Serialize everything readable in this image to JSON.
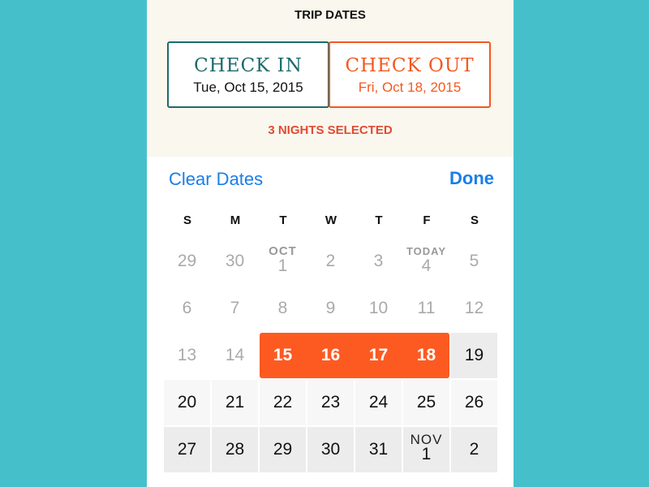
{
  "header": {
    "title": "TRIP DATES",
    "check_in": {
      "label": "CHECK IN",
      "date": "Tue, Oct 15, 2015"
    },
    "check_out": {
      "label": "CHECK OUT",
      "date": "Fri, Oct 18, 2015"
    },
    "nights": "3 NIGHTS SELECTED"
  },
  "toolbar": {
    "clear_label": "Clear Dates",
    "done_label": "Done"
  },
  "colors": {
    "background": "#45c0cb",
    "check_in": "#1d6b6b",
    "check_out": "#f4581f",
    "selected": "#fd5a22",
    "link": "#1a7ee8"
  },
  "calendar": {
    "weekdays": [
      "S",
      "M",
      "T",
      "W",
      "T",
      "F",
      "S"
    ],
    "weeks": [
      [
        {
          "day": "29",
          "state": "past"
        },
        {
          "day": "30",
          "state": "past"
        },
        {
          "day": "1",
          "label": "OCT",
          "state": "past"
        },
        {
          "day": "2",
          "state": "past"
        },
        {
          "day": "3",
          "state": "past"
        },
        {
          "day": "4",
          "label": "TODAY",
          "state": "past",
          "today": true
        },
        {
          "day": "5",
          "state": "past"
        }
      ],
      [
        {
          "day": "6",
          "state": "past"
        },
        {
          "day": "7",
          "state": "past"
        },
        {
          "day": "8",
          "state": "past"
        },
        {
          "day": "9",
          "state": "past"
        },
        {
          "day": "10",
          "state": "past"
        },
        {
          "day": "11",
          "state": "past"
        },
        {
          "day": "12",
          "state": "past"
        }
      ],
      [
        {
          "day": "13",
          "state": "past"
        },
        {
          "day": "14",
          "state": "past"
        },
        {
          "day": "15",
          "state": "selected"
        },
        {
          "day": "16",
          "state": "selected"
        },
        {
          "day": "17",
          "state": "selected"
        },
        {
          "day": "18",
          "state": "selected"
        },
        {
          "day": "19",
          "state": "available"
        }
      ],
      [
        {
          "day": "20",
          "state": "available",
          "light": true
        },
        {
          "day": "21",
          "state": "available",
          "light": true
        },
        {
          "day": "22",
          "state": "available",
          "light": true
        },
        {
          "day": "23",
          "state": "available",
          "light": true
        },
        {
          "day": "24",
          "state": "available",
          "light": true
        },
        {
          "day": "25",
          "state": "available",
          "light": true
        },
        {
          "day": "26",
          "state": "available",
          "light": true
        }
      ],
      [
        {
          "day": "27",
          "state": "available"
        },
        {
          "day": "28",
          "state": "available"
        },
        {
          "day": "29",
          "state": "available"
        },
        {
          "day": "30",
          "state": "available"
        },
        {
          "day": "31",
          "state": "available"
        },
        {
          "day": "1",
          "label": "NOV",
          "state": "available"
        },
        {
          "day": "2",
          "state": "available"
        }
      ]
    ]
  }
}
